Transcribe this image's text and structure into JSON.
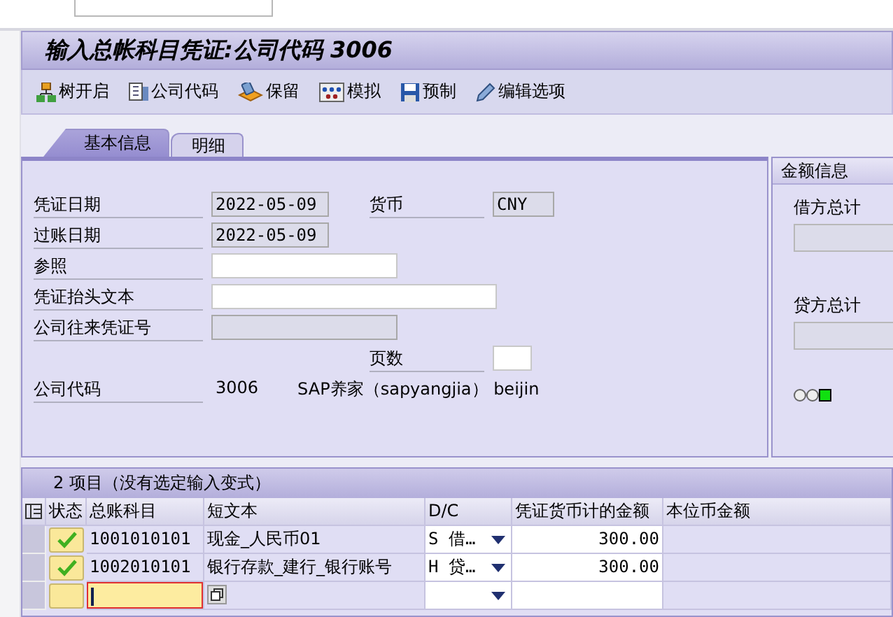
{
  "title": "输入总帐科目凭证:公司代码 3006",
  "toolbar": [
    {
      "label": "树开启"
    },
    {
      "label": "公司代码"
    },
    {
      "label": "保留"
    },
    {
      "label": "模拟"
    },
    {
      "label": "预制"
    },
    {
      "label": "编辑选项"
    }
  ],
  "tabs": [
    {
      "label": "基本信息",
      "selected": true
    },
    {
      "label": "明细",
      "selected": false
    }
  ],
  "header_rows": [
    {
      "label": "凭证日期",
      "field": {
        "kind": "display",
        "value": "2022-05-09"
      },
      "label_2": "货币",
      "field_2": {
        "kind": "display",
        "value": "CNY"
      }
    },
    {
      "label": "过账日期",
      "field": {
        "kind": "display",
        "value": "2022-05-09"
      }
    },
    {
      "label": "参照",
      "field": {
        "kind": "input"
      }
    },
    {
      "label": "凭证抬头文本",
      "field": {
        "kind": "input"
      }
    },
    {
      "label": "公司往来凭证号",
      "field": {
        "kind": "display"
      }
    },
    {
      "label_2": "页数",
      "field_2": {
        "kind": "input"
      }
    }
  ],
  "company": {
    "label": "公司代码",
    "code": "3006",
    "name": "SAP养家（sapyangjia） beijin"
  },
  "amount_panel": {
    "title": "金额信息",
    "debit_label": "借方总计",
    "credit_label": "贷方总计",
    "lights": [
      {
        "on": false
      },
      {
        "on": false
      },
      {
        "on": true
      }
    ]
  },
  "table": {
    "title": "2 项目（没有选定输入变式）",
    "columns": [
      "状态",
      "总账科目",
      "短文本",
      "D/C",
      "凭证货币计的金额",
      "本位币金额"
    ],
    "rows": [
      {
        "checked": true,
        "account": "1001010101",
        "text": "现金_人民币01",
        "dc": "S 借…",
        "amount": "300.00",
        "focused": false
      },
      {
        "checked": true,
        "account": "1002010101",
        "text": "银行存款_建行_银行账号",
        "dc": "H 贷…",
        "amount": "300.00",
        "focused": false
      },
      {
        "checked": false,
        "focused": true
      }
    ]
  }
}
